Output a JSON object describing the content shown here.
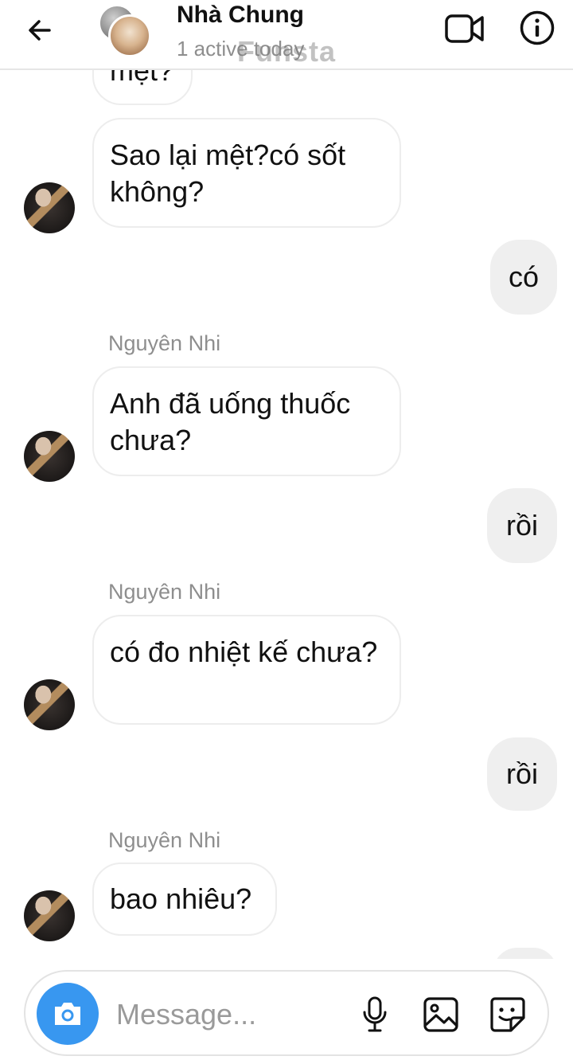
{
  "header": {
    "title": "Nhà Chung",
    "status": "1 active today",
    "watermark": "Funsta"
  },
  "messages": [
    {
      "type": "received",
      "text": "mệt?"
    },
    {
      "type": "received",
      "text": "Sao lại mệt?có sốt không?"
    },
    {
      "type": "sent",
      "text": "có"
    },
    {
      "type": "sender",
      "text": "Nguyên Nhi"
    },
    {
      "type": "received",
      "text": "Anh đã uống thuốc chưa?"
    },
    {
      "type": "sent",
      "text": "rồi"
    },
    {
      "type": "sender",
      "text": "Nguyên Nhi"
    },
    {
      "type": "received",
      "text": "có đo nhiệt kế chưa?"
    },
    {
      "type": "sent",
      "text": "rồi"
    },
    {
      "type": "sender",
      "text": "Nguyên Nhi"
    },
    {
      "type": "received",
      "text": "bao nhiêu?"
    }
  ],
  "composer": {
    "placeholder": "Message..."
  },
  "icons": {
    "back": "arrow-left-icon",
    "video": "video-camera-icon",
    "info": "info-icon",
    "camera": "camera-icon",
    "mic": "microphone-icon",
    "gallery": "image-icon",
    "sticker": "sticker-icon"
  },
  "colors": {
    "accent": "#3897f0",
    "sent_bubble": "#efefef",
    "received_border": "#ededed",
    "secondary_text": "#8e8e8e"
  }
}
